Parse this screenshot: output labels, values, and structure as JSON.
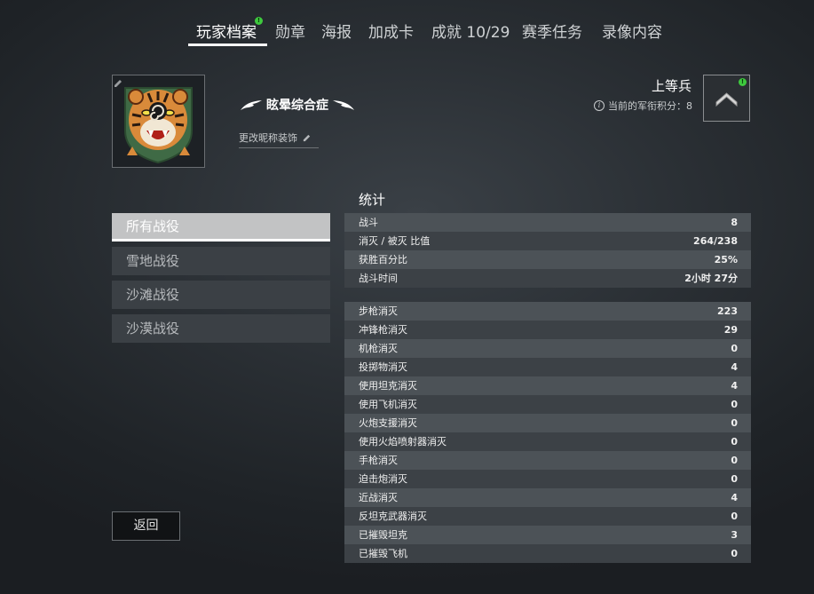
{
  "tabs": [
    {
      "label": "玩家档案",
      "active": true,
      "badge": "!"
    },
    {
      "label": "勋章"
    },
    {
      "label": "海报"
    },
    {
      "label": "加成卡"
    },
    {
      "label": "成就 10/29"
    },
    {
      "label": "赛季任务"
    },
    {
      "label": "录像内容"
    }
  ],
  "profile": {
    "nickname": "眩晕综合症",
    "change_nickname_label": "更改昵称装饰",
    "rank_title": "上等兵",
    "rank_points_label": "当前的军衔积分：8",
    "rank_badge_alert": "!"
  },
  "stats_title": "统计",
  "campaigns": [
    {
      "label": "所有战役",
      "active": true
    },
    {
      "label": "雪地战役"
    },
    {
      "label": "沙滩战役"
    },
    {
      "label": "沙漠战役"
    }
  ],
  "back_label": "返回",
  "summary_stats": [
    {
      "label": "战斗",
      "value": "8"
    },
    {
      "label": "消灭 / 被灭 比值",
      "value": "264/238"
    },
    {
      "label": "获胜百分比",
      "value": "25%"
    },
    {
      "label": "战斗时间",
      "value": "2小时 27分"
    }
  ],
  "kill_stats": [
    {
      "label": "步枪消灭",
      "value": "223"
    },
    {
      "label": "冲锋枪消灭",
      "value": "29"
    },
    {
      "label": "机枪消灭",
      "value": "0"
    },
    {
      "label": "投掷物消灭",
      "value": "4"
    },
    {
      "label": "使用坦克消灭",
      "value": "4"
    },
    {
      "label": "使用飞机消灭",
      "value": "0"
    },
    {
      "label": "火炮支援消灭",
      "value": "0"
    },
    {
      "label": "使用火焰喷射器消灭",
      "value": "0"
    },
    {
      "label": "手枪消灭",
      "value": "0"
    },
    {
      "label": "迫击炮消灭",
      "value": "0"
    },
    {
      "label": "近战消灭",
      "value": "4"
    },
    {
      "label": "反坦克武器消灭",
      "value": "0"
    },
    {
      "label": "已摧毁坦克",
      "value": "3"
    },
    {
      "label": "已摧毁飞机",
      "value": "0"
    }
  ],
  "colors": {
    "accent_green": "#3ec93e",
    "active_campaign": "#c2c3c4"
  }
}
